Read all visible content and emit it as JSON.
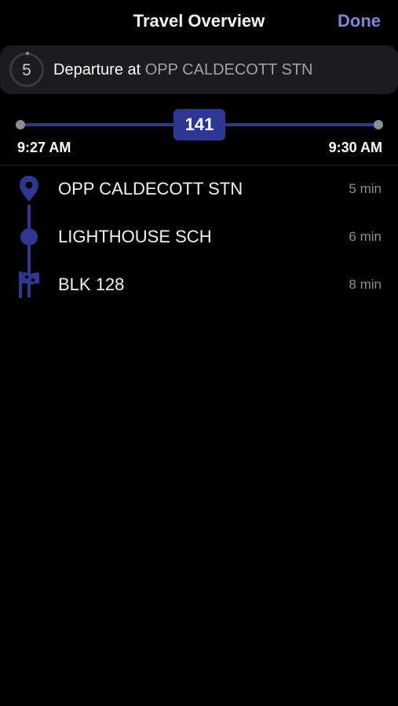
{
  "header": {
    "title": "Travel Overview",
    "done_label": "Done"
  },
  "banner": {
    "countdown": "5",
    "departure_prefix": "Departure at",
    "departure_stop": "OPP CALDECOTT STN"
  },
  "timeline": {
    "bus_number": "141",
    "start_time": "9:27 AM",
    "end_time": "9:30 AM"
  },
  "stops": [
    {
      "name": "OPP CALDECOTT STN",
      "eta": "5 min",
      "icon": "location-pin-icon"
    },
    {
      "name": "LIGHTHOUSE SCH",
      "eta": "6 min",
      "icon": "stop-dot-icon"
    },
    {
      "name": "BLK 128",
      "eta": "8 min",
      "icon": "destination-flag-icon"
    }
  ],
  "colors": {
    "accent": "#2e3892",
    "link": "#7f86d6",
    "background": "#000000",
    "banner": "#1c1c1e",
    "muted": "#8e8e93"
  }
}
